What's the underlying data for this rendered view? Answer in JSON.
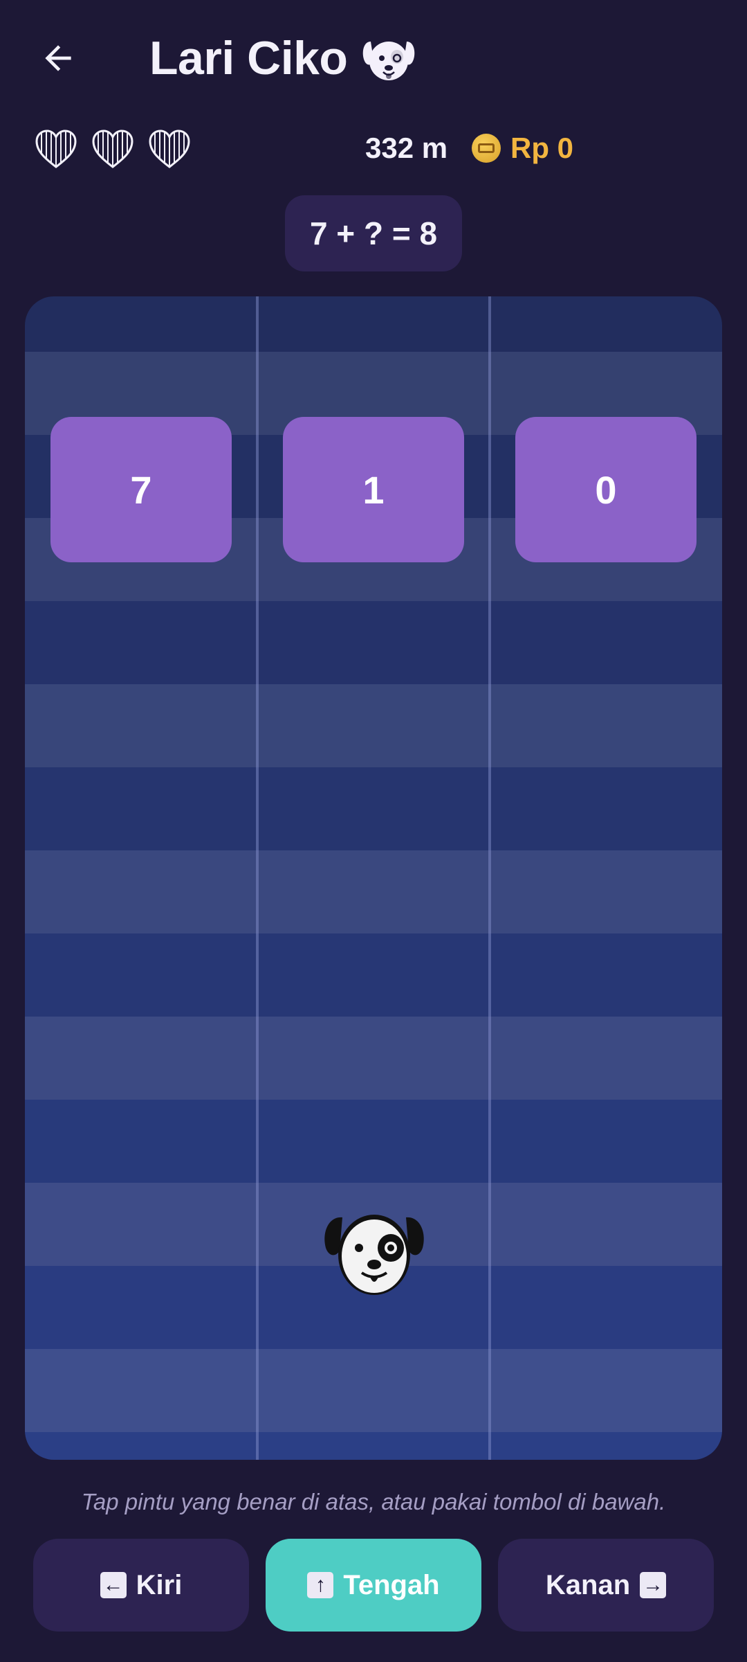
{
  "header": {
    "back_icon": "arrow-left-icon",
    "title": "Lari Ciko",
    "title_icon": "dog-face-icon"
  },
  "stats": {
    "lives": 3,
    "distance": "332 m",
    "coins": "Rp 0",
    "coin_icon": "coin-icon"
  },
  "question": "7 + ? = 8",
  "doors": [
    {
      "lane": "left",
      "value": "7"
    },
    {
      "lane": "middle",
      "value": "1"
    },
    {
      "lane": "right",
      "value": "0"
    }
  ],
  "runner": {
    "lane": "middle",
    "icon": "dog-face-icon"
  },
  "hint": "Tap pintu yang benar di atas, atau pakai tombol di bawah.",
  "controls": {
    "left": {
      "label": "Kiri",
      "key_icon": "←"
    },
    "middle": {
      "label": "Tengah",
      "key_icon": "↑"
    },
    "right": {
      "label": "Kanan",
      "key_icon": "→"
    }
  },
  "colors": {
    "background": "#1d1836",
    "panel": "#2d2352",
    "door": "#8b62c8",
    "accent": "#4ecdc4",
    "coin_text": "#f2b540"
  }
}
